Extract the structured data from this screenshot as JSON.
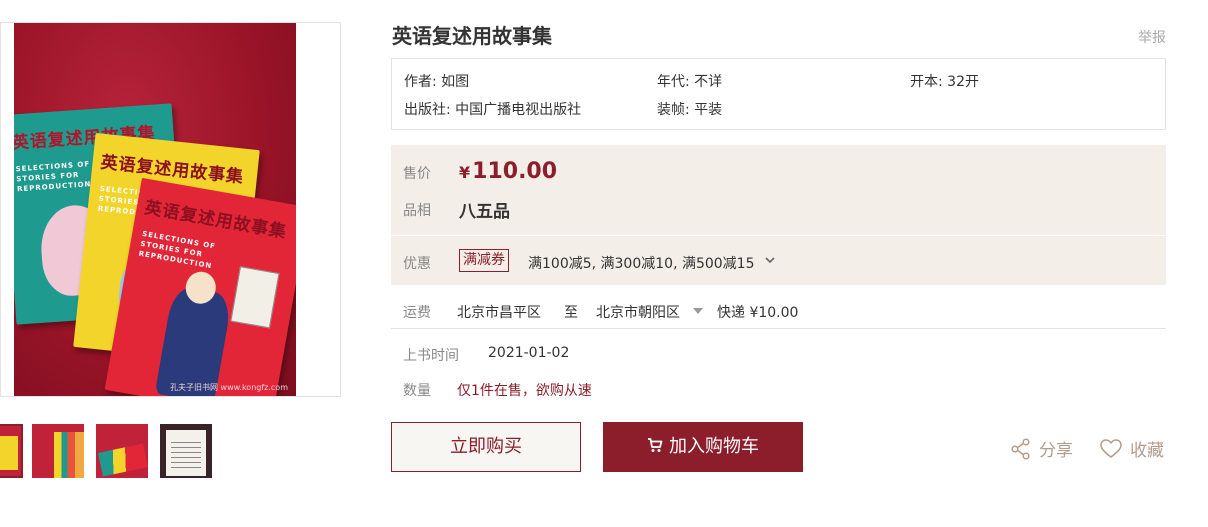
{
  "product": {
    "title": "英语复述用故事集",
    "report_label": "举报"
  },
  "meta": {
    "author": "作者: 如图",
    "year": "年代: 不详",
    "format": "开本: 32开",
    "publisher": "出版社: 中国广播电视出版社",
    "binding": "装帧: 平装"
  },
  "pricing": {
    "price_label": "售价",
    "currency": "¥",
    "price": "110.00",
    "grade_label": "品相",
    "grade": "八五品",
    "discount_label": "优惠",
    "coupon_tag": "满减券",
    "coupon_text": "满100减5, 满300减10, 满500减15"
  },
  "shipping": {
    "label": "运费",
    "from": "北京市昌平区",
    "to_word": "至",
    "to": "北京市朝阳区",
    "method": "快递 ¥10.00"
  },
  "listing": {
    "date_label": "上书时间",
    "date": "2021-01-02",
    "qty_label": "数量",
    "qty": "仅1件在售，欲购从速"
  },
  "actions": {
    "buy_now": "立即购买",
    "add_to_cart": "加入购物车",
    "share": "分享",
    "favorite": "收藏"
  },
  "photo": {
    "book_title": "英语复述用故事集",
    "book_subtitle_1": "SELECTIONS OF",
    "book_subtitle_2": "STORIES FOR",
    "book_subtitle_3": "REPRODUCTION",
    "watermark": "孔夫子旧书网 www.kongfz.com"
  },
  "colors": {
    "accent": "#8c1d2a",
    "panel_bg": "#f3eee7",
    "action_text": "#b39c8a"
  }
}
